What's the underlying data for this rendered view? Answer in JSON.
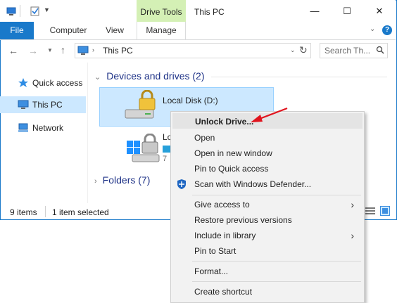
{
  "titlebar": {
    "contextual_tab": "Drive Tools",
    "title": "This PC",
    "minimize_glyph": "—",
    "maximize_glyph": "☐",
    "close_glyph": "✕"
  },
  "ribbon": {
    "file_label": "File",
    "computer_label": "Computer",
    "view_label": "View",
    "manage_label": "Manage"
  },
  "address": {
    "location": "This PC",
    "search_placeholder": "Search Th..."
  },
  "nav_pane": {
    "items": [
      {
        "label": "Quick access",
        "icon": "star-icon"
      },
      {
        "label": "This PC",
        "icon": "computer-icon"
      },
      {
        "label": "Network",
        "icon": "network-icon"
      }
    ]
  },
  "content": {
    "devices_header": "Devices and drives (2)",
    "folders_header": "Folders (7)",
    "drive1_name": "Local Disk (D:)",
    "drive2_name_partial": "Lo",
    "drive2_size_partial": "7"
  },
  "status_bar": {
    "items_count": "9 items",
    "selection": "1 item selected"
  },
  "context_menu": {
    "items": [
      {
        "label": "Unlock Drive...",
        "bold": true
      },
      {
        "label": "Open"
      },
      {
        "label": "Open in new window"
      },
      {
        "label": "Pin to Quick access"
      },
      {
        "label": "Scan with Windows Defender..."
      },
      {
        "label": "Give access to",
        "submenu": true
      },
      {
        "label": "Restore previous versions"
      },
      {
        "label": "Include in library",
        "submenu": true
      },
      {
        "label": "Pin to Start"
      },
      {
        "label": "Format..."
      },
      {
        "label": "Create shortcut"
      }
    ]
  },
  "colors": {
    "accent": "#1979ca",
    "contextual_tab": "#d4f0b5",
    "selection": "#cce8ff",
    "annotation_arrow": "#e0141e"
  }
}
